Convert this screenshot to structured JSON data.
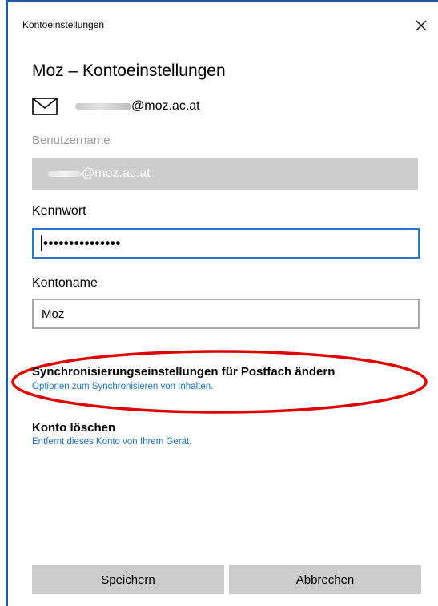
{
  "window": {
    "title": "Kontoeinstellungen"
  },
  "dialog": {
    "heading": "Moz – Kontoeinstellungen",
    "account_email_domain": "@moz.ac.at"
  },
  "username": {
    "label": "Benutzername",
    "value_domain": "@moz.ac.at"
  },
  "password": {
    "label": "Kennwort",
    "value_masked": "•••••••••••••••"
  },
  "account_name": {
    "label": "Kontoname",
    "value": "Moz"
  },
  "sync_settings": {
    "title": "Synchronisierungseinstellungen für Postfach ändern",
    "link": "Optionen zum Synchronisieren von Inhalten."
  },
  "delete_account": {
    "title": "Konto löschen",
    "link": "Entfernt dieses Konto von Ihrem Gerät."
  },
  "buttons": {
    "save": "Speichern",
    "cancel": "Abbrechen"
  },
  "colors": {
    "accent": "#2b78c6",
    "link": "#1a73c8",
    "highlight_ellipse": "#e00000",
    "button_bg": "#cccccc",
    "disabled_input_bg": "#cdcdcd"
  },
  "icons": {
    "close": "close-icon",
    "mail": "mail-icon"
  }
}
